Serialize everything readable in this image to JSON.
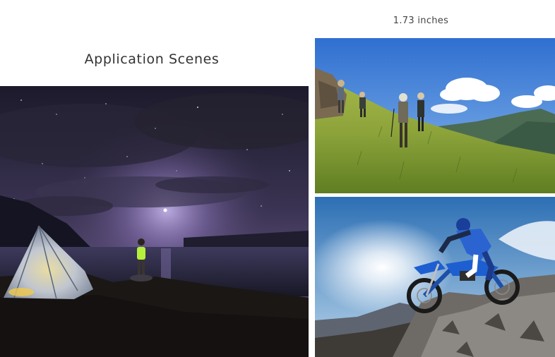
{
  "header": {
    "dimension_caption": "1.73 inches",
    "title": "Application Scenes"
  },
  "photos": [
    {
      "scene": "night-camping"
    },
    {
      "scene": "mountain-hiking"
    },
    {
      "scene": "motocross"
    }
  ]
}
